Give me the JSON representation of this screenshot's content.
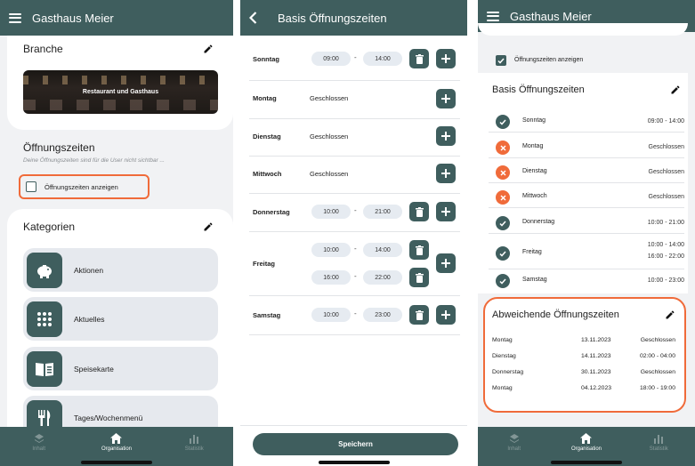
{
  "screen1": {
    "title": "Gasthaus Meier",
    "branche_label": "Branche",
    "banner_text": "Restaurant und Gasthaus",
    "opening_title": "Öffnungszeiten",
    "opening_hint": "Deine Öffnungszeiten sind für die User nicht sichtbar ...",
    "checkbox_label": "Öffnungszeiten anzeigen",
    "checkbox_checked": false,
    "categories_title": "Kategorien",
    "categories": [
      {
        "label": "Aktionen",
        "icon": "piggy-bank-icon"
      },
      {
        "label": "Aktuelles",
        "icon": "dots-grid-icon"
      },
      {
        "label": "Speisekarte",
        "icon": "menu-book-icon"
      },
      {
        "label": "Tages/Wochenmenü",
        "icon": "cutlery-icon"
      }
    ],
    "nav": [
      {
        "label": "Inhalt",
        "icon": "layers-icon",
        "active": false
      },
      {
        "label": "Organisation",
        "icon": "home-icon",
        "active": true
      },
      {
        "label": "Statistik",
        "icon": "bar-chart-icon",
        "active": false
      }
    ]
  },
  "screen2": {
    "title": "Basis Öffnungszeiten",
    "days": [
      {
        "name": "Sonntag",
        "ranges": [
          [
            "09:00",
            "14:00"
          ]
        ]
      },
      {
        "name": "Montag",
        "closed": "Geschlossen"
      },
      {
        "name": "Dienstag",
        "closed": "Geschlossen"
      },
      {
        "name": "Mittwoch",
        "closed": "Geschlossen"
      },
      {
        "name": "Donnerstag",
        "ranges": [
          [
            "10:00",
            "21:00"
          ]
        ]
      },
      {
        "name": "Freitag",
        "ranges": [
          [
            "10:00",
            "14:00"
          ],
          [
            "16:00",
            "22:00"
          ]
        ]
      },
      {
        "name": "Samstag",
        "ranges": [
          [
            "10:00",
            "23:00"
          ]
        ]
      }
    ],
    "dash": "-",
    "save_label": "Speichern"
  },
  "screen3": {
    "title": "Gasthaus Meier",
    "checkbox_label": "Öffnungszeiten anzeigen",
    "checkbox_checked": true,
    "basis_title": "Basis Öffnungszeiten",
    "basis": [
      {
        "day": "Sonntag",
        "open": true,
        "hours": "09:00 - 14:00"
      },
      {
        "day": "Montag",
        "open": false,
        "hours": "Geschlossen"
      },
      {
        "day": "Dienstag",
        "open": false,
        "hours": "Geschlossen"
      },
      {
        "day": "Mittwoch",
        "open": false,
        "hours": "Geschlossen"
      },
      {
        "day": "Donnerstag",
        "open": true,
        "hours": "10:00 - 21:00"
      },
      {
        "day": "Freitag",
        "open": true,
        "hours": "10:00 - 14:00",
        "hours2": "16:00 - 22:00"
      },
      {
        "day": "Samstag",
        "open": true,
        "hours": "10:00 - 23:00"
      }
    ],
    "deviations_title": "Abweichende Öffnungszeiten",
    "deviations": [
      {
        "day": "Montag",
        "date": "13.11.2023",
        "hours": "Geschlossen"
      },
      {
        "day": "Dienstag",
        "date": "14.11.2023",
        "hours": "02:00 - 04:00"
      },
      {
        "day": "Donnerstag",
        "date": "30.11.2023",
        "hours": "Geschlossen"
      },
      {
        "day": "Montag",
        "date": "04.12.2023",
        "hours": "18:00 - 19:00"
      }
    ],
    "nav": [
      {
        "label": "Inhalt",
        "icon": "layers-icon",
        "active": false
      },
      {
        "label": "Organisation",
        "icon": "home-icon",
        "active": true
      },
      {
        "label": "Statistik",
        "icon": "bar-chart-icon",
        "active": false
      }
    ]
  },
  "colors": {
    "primary": "#3f5e5e",
    "highlight": "#f06b3a",
    "open_green": "#3f5e5e",
    "closed_orange": "#f06b3a",
    "background": "#f1f2f4",
    "pill": "#e6ebf1"
  }
}
